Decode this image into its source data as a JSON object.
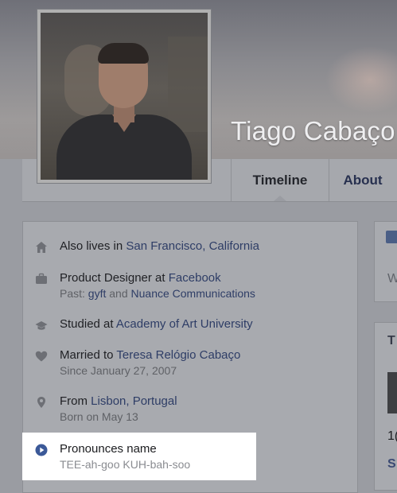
{
  "profile": {
    "name": "Tiago Cabaço"
  },
  "nav": {
    "tabs": [
      {
        "label": "Timeline"
      },
      {
        "label": "About"
      }
    ]
  },
  "intro": {
    "also_lives": {
      "prefix": "Also lives in ",
      "link": "San Francisco, California"
    },
    "work": {
      "prefix": "Product Designer at ",
      "link": "Facebook",
      "past_prefix": "Past: ",
      "past_link1": "gyft",
      "past_mid": " and ",
      "past_link2": "Nuance Communications"
    },
    "education": {
      "prefix": "Studied at ",
      "link": "Academy of Art University"
    },
    "relationship": {
      "prefix": "Married to ",
      "link": "Teresa Relógio Cabaço",
      "since": "Since January 27, 2007"
    },
    "from": {
      "prefix": "From ",
      "link": "Lisbon, Portugal",
      "born": "Born on May 13"
    },
    "pronounce": {
      "title": "Pronounces name",
      "phonetic": "TEE-ah-goo KUH-bah-soo"
    }
  },
  "side": {
    "w": "W",
    "t": "T",
    "one": "1(",
    "s": "S"
  },
  "colors": {
    "link": "#2e3d66",
    "accent": "#3b5998",
    "highlight_bg": "#ffffff"
  },
  "icons": [
    "home-icon",
    "briefcase-icon",
    "graduation-cap-icon",
    "heart-icon",
    "location-pin-icon",
    "play-icon"
  ]
}
